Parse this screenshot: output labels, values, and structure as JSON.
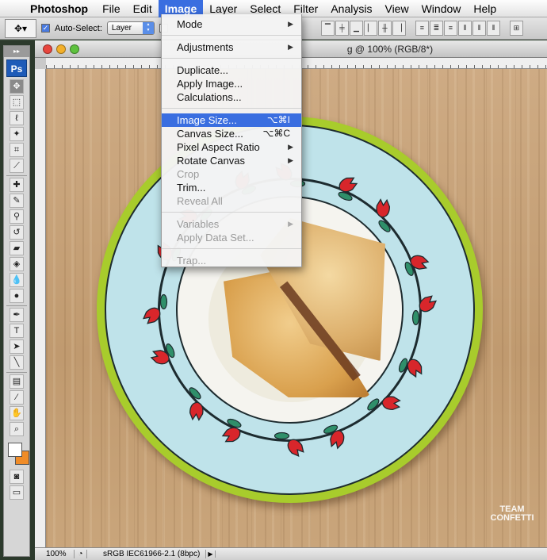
{
  "menubar": {
    "app_name": "Photoshop",
    "menus": [
      "File",
      "Edit",
      "Image",
      "Layer",
      "Select",
      "Filter",
      "Analysis",
      "View",
      "Window",
      "Help"
    ],
    "active_menu": "Image"
  },
  "options_bar": {
    "auto_select_label": "Auto-Select:",
    "auto_select_value": "Layer"
  },
  "document": {
    "title": "sandwich.jpg @ 100% (RGB/8*)",
    "visible_title_fragment": "g @ 100% (RGB/8*)"
  },
  "status_bar": {
    "zoom": "100%",
    "profile": "sRGB IEC61966-2.1 (8bpc)"
  },
  "image_menu": {
    "mode": "Mode",
    "adjustments": "Adjustments",
    "duplicate": "Duplicate...",
    "apply_image": "Apply Image...",
    "calculations": "Calculations...",
    "image_size": "Image Size...",
    "image_size_shortcut": "⌥⌘I",
    "canvas_size": "Canvas Size...",
    "canvas_size_shortcut": "⌥⌘C",
    "pixel_aspect_ratio": "Pixel Aspect Ratio",
    "rotate_canvas": "Rotate Canvas",
    "crop": "Crop",
    "trim": "Trim...",
    "reveal_all": "Reveal All",
    "variables": "Variables",
    "apply_data_set": "Apply Data Set...",
    "trap": "Trap..."
  },
  "tools_panel": {
    "logo": "Ps"
  },
  "watermark": {
    "line1": "TEAM",
    "line2": "CONFETTI"
  },
  "colors": {
    "highlight": "#3a6ee0",
    "foreground_swatch": "#ffffff",
    "background_swatch": "#f08c28"
  }
}
